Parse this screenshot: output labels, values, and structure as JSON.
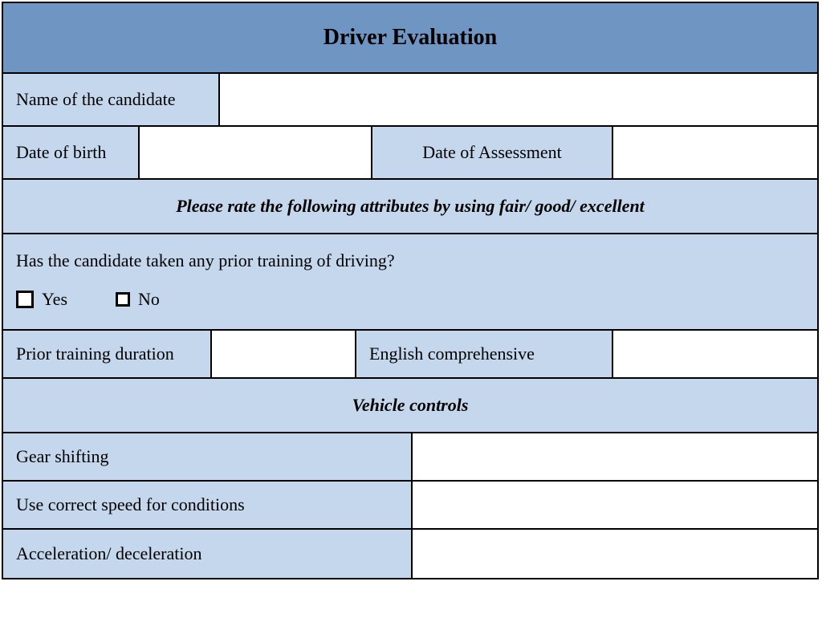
{
  "title": "Driver Evaluation",
  "fields": {
    "name_label": "Name of the candidate",
    "dob_label": "Date of birth",
    "assessment_label": "Date of Assessment",
    "training_duration_label": "Prior training duration",
    "english_label": "English comprehensive"
  },
  "instructions": "Please rate the following attributes by using fair/ good/ excellent",
  "question": {
    "text": "Has the candidate taken any prior training of driving?",
    "yes": "Yes",
    "no": "No"
  },
  "section2": "Vehicle controls",
  "attributes": {
    "gear": "Gear shifting",
    "speed": "Use correct speed for conditions",
    "accel": "Acceleration/ deceleration"
  }
}
